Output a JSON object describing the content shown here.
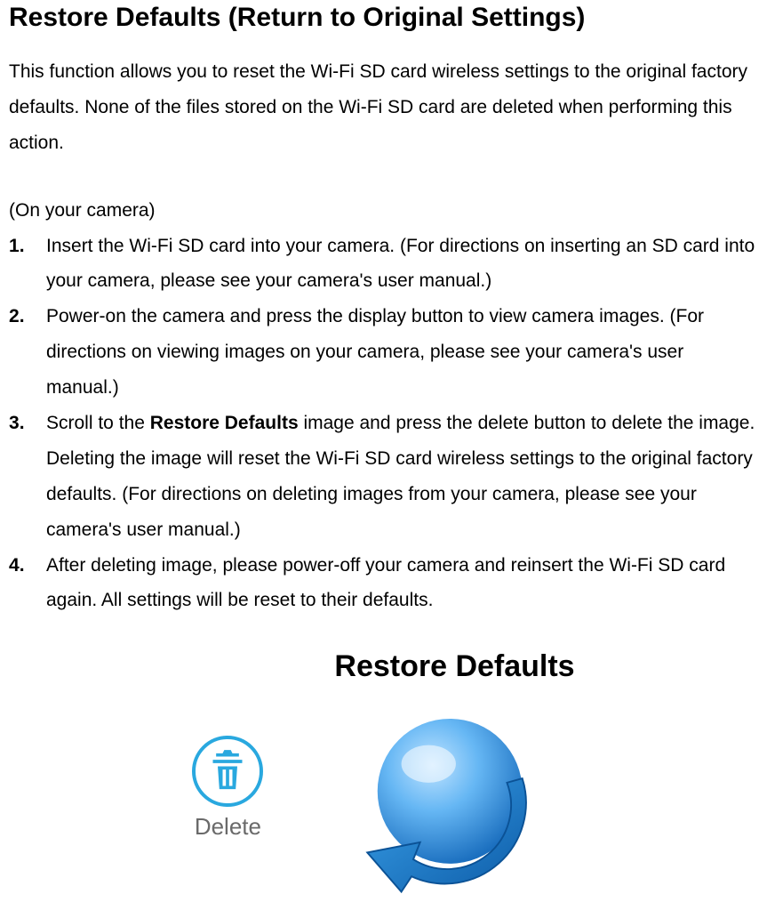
{
  "heading": "Restore Defaults (Return to Original Settings)",
  "intro": "This function allows you to reset the Wi-Fi SD card wireless settings to the original factory defaults. None of the files stored on the Wi-Fi SD card are deleted when performing this action.",
  "context": "(On your camera)",
  "steps": {
    "s1": "Insert the Wi-Fi SD card into your camera. (For directions on inserting an SD card into your camera, please see your camera's user manual.)",
    "s2": "Power-on the camera and press the display button to view camera images. (For directions on viewing images on your camera, please see your camera's user manual.)",
    "s3_a": "Scroll to the ",
    "s3_b": "Restore Defaults",
    "s3_c": " image and press the delete button to delete the image. Deleting the image will reset the Wi-Fi SD card wireless settings to the original factory defaults. (For directions on deleting images from your camera, please see your camera's user manual.)",
    "s4": "After deleting image, please power-off your camera and reinsert the Wi-Fi SD card again. All settings will be reset to their defaults."
  },
  "figure": {
    "delete_label": "Delete",
    "restore_title": "Restore Defaults"
  }
}
